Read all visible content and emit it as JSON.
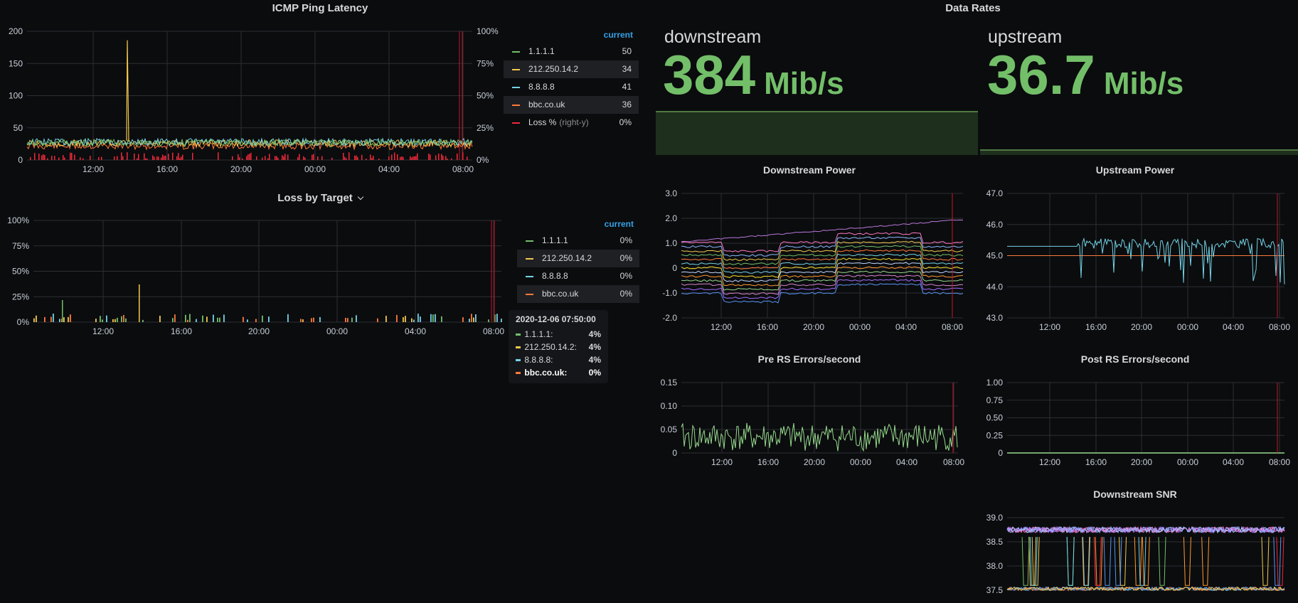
{
  "colors": {
    "green": "#73bf69",
    "yellow": "#f2c94c",
    "cyan": "#73d2e6",
    "orange": "#ff7a3b",
    "red": "#f2293a",
    "lightgreen": "#96d98d",
    "accent": "#33a2e5"
  },
  "panels": {
    "icmp": {
      "title": "ICMP Ping Latency",
      "y_ticks": [
        "200",
        "150",
        "100",
        "50",
        "0"
      ],
      "y2_ticks": [
        "100%",
        "75%",
        "50%",
        "25%",
        "0%"
      ],
      "x_ticks": [
        "12:00",
        "16:00",
        "20:00",
        "00:00",
        "04:00",
        "08:00"
      ],
      "legend_header": "current",
      "legend": [
        {
          "name": "1.1.1.1",
          "value": "50",
          "color": "#73bf69"
        },
        {
          "name": "212.250.14.2",
          "value": "34",
          "color": "#f2c94c"
        },
        {
          "name": "8.8.8.8",
          "value": "41",
          "color": "#73d2e6"
        },
        {
          "name": "bbc.co.uk",
          "value": "36",
          "color": "#ff7a3b"
        },
        {
          "name": "Loss %",
          "note": "(right-y)",
          "value": "0%",
          "color": "#f2293a"
        }
      ]
    },
    "loss": {
      "title": "Loss by Target",
      "y_ticks": [
        "100%",
        "75%",
        "50%",
        "25%",
        "0%"
      ],
      "x_ticks": [
        "12:00",
        "16:00",
        "20:00",
        "00:00",
        "04:00",
        "08:00"
      ],
      "legend_header": "current",
      "legend": [
        {
          "name": "1.1.1.1",
          "value": "0%",
          "color": "#73bf69"
        },
        {
          "name": "212.250.14.2",
          "value": "0%",
          "color": "#f2c94c"
        },
        {
          "name": "8.8.8.8",
          "value": "0%",
          "color": "#73d2e6"
        },
        {
          "name": "bbc.co.uk",
          "value": "0%",
          "color": "#ff7a3b"
        }
      ],
      "tooltip": {
        "time": "2020-12-06 07:50:00",
        "rows": [
          {
            "name": "1.1.1.1:",
            "value": "4%",
            "color": "#73bf69"
          },
          {
            "name": "212.250.14.2:",
            "value": "4%",
            "color": "#f2c94c"
          },
          {
            "name": "8.8.8.8:",
            "value": "4%",
            "color": "#73d2e6"
          },
          {
            "name": "bbc.co.uk:",
            "value": "0%",
            "color": "#ff7a3b"
          }
        ]
      }
    },
    "rates": {
      "title": "Data Rates",
      "down": {
        "label": "downstream",
        "value": "384",
        "unit": "Mib/s"
      },
      "up": {
        "label": "upstream",
        "value": "36.7",
        "unit": "Mib/s"
      }
    },
    "dpower": {
      "title": "Downstream Power",
      "y_ticks": [
        "3.0",
        "2.0",
        "1.0",
        "0",
        "-1.0",
        "-2.0"
      ],
      "x_ticks": [
        "12:00",
        "16:00",
        "20:00",
        "00:00",
        "04:00",
        "08:00"
      ]
    },
    "upower": {
      "title": "Upstream Power",
      "y_ticks": [
        "47.0",
        "46.0",
        "45.0",
        "44.0",
        "43.0"
      ],
      "x_ticks": [
        "12:00",
        "16:00",
        "20:00",
        "00:00",
        "04:00",
        "08:00"
      ]
    },
    "prers": {
      "title": "Pre RS Errors/second",
      "y_ticks": [
        "0.15",
        "0.10",
        "0.05",
        "0"
      ],
      "x_ticks": [
        "12:00",
        "16:00",
        "20:00",
        "00:00",
        "04:00",
        "08:00"
      ]
    },
    "postrs": {
      "title": "Post RS Errors/second",
      "y_ticks": [
        "1.00",
        "0.75",
        "0.50",
        "0.25",
        "0"
      ],
      "x_ticks": [
        "12:00",
        "16:00",
        "20:00",
        "00:00",
        "04:00",
        "08:00"
      ]
    },
    "snr": {
      "title": "Downstream SNR",
      "y_ticks": [
        "39.0",
        "38.5",
        "38.0",
        "37.5"
      ]
    }
  },
  "chart_data": [
    {
      "type": "line",
      "title": "ICMP Ping Latency",
      "x": [
        "12:00",
        "16:00",
        "20:00",
        "00:00",
        "04:00",
        "08:00"
      ],
      "ylim": [
        0,
        200
      ],
      "y2lim": [
        "0%",
        "100%"
      ],
      "series": [
        {
          "name": "1.1.1.1",
          "current": 50
        },
        {
          "name": "212.250.14.2",
          "current": 34
        },
        {
          "name": "8.8.8.8",
          "current": 41
        },
        {
          "name": "bbc.co.uk",
          "current": 36
        },
        {
          "name": "Loss %",
          "current": "0%"
        }
      ]
    },
    {
      "type": "bar",
      "title": "Loss by Target",
      "x": [
        "12:00",
        "16:00",
        "20:00",
        "00:00",
        "04:00",
        "08:00"
      ],
      "ylim": [
        "0%",
        "100%"
      ],
      "series": [
        {
          "name": "1.1.1.1",
          "current": "0%"
        },
        {
          "name": "212.250.14.2",
          "current": "0%"
        },
        {
          "name": "8.8.8.8",
          "current": "0%"
        },
        {
          "name": "bbc.co.uk",
          "current": "0%"
        }
      ]
    },
    {
      "type": "line",
      "title": "Downstream Power",
      "ylim": [
        -2.0,
        3.0
      ]
    },
    {
      "type": "line",
      "title": "Upstream Power",
      "ylim": [
        43.0,
        47.0
      ]
    },
    {
      "type": "line",
      "title": "Pre RS Errors/second",
      "ylim": [
        0,
        0.15
      ]
    },
    {
      "type": "line",
      "title": "Post RS Errors/second",
      "ylim": [
        0,
        1.0
      ]
    },
    {
      "type": "line",
      "title": "Downstream SNR",
      "ylim": [
        37.5,
        39.0
      ]
    }
  ]
}
